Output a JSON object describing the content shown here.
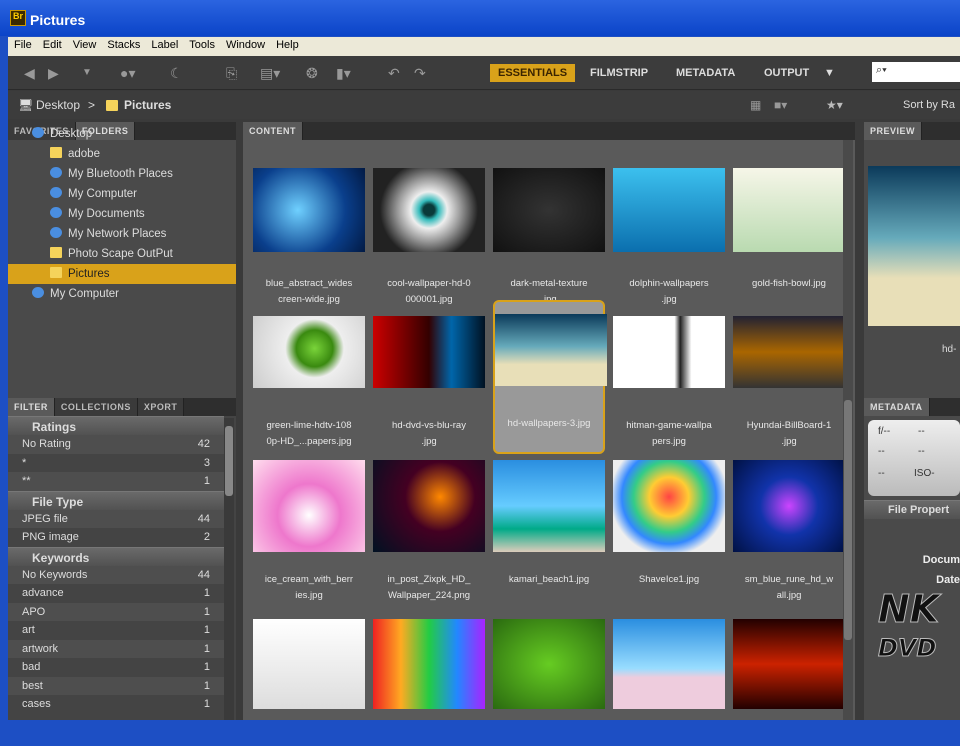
{
  "window": {
    "title": "Pictures",
    "app_icon": "Br"
  },
  "menu": [
    "File",
    "Edit",
    "View",
    "Stacks",
    "Label",
    "Tools",
    "Window",
    "Help"
  ],
  "workspaces": {
    "items": [
      "ESSENTIALS",
      "FILMSTRIP",
      "METADATA",
      "OUTPUT"
    ],
    "active": "ESSENTIALS"
  },
  "search": {
    "placeholder": "⌕▾"
  },
  "path": {
    "root": "Desktop",
    "sep": ">",
    "current": "Pictures"
  },
  "sort_label": "Sort by Ra",
  "left_tabs": [
    "FAVORITES",
    "FOLDERS"
  ],
  "tree": [
    {
      "label": "Desktop",
      "level": 0
    },
    {
      "label": "adobe",
      "level": 1
    },
    {
      "label": "My Bluetooth Places",
      "level": 1
    },
    {
      "label": "My Computer",
      "level": 1
    },
    {
      "label": "My Documents",
      "level": 1
    },
    {
      "label": "My Network Places",
      "level": 1
    },
    {
      "label": "Photo Scape OutPut",
      "level": 1
    },
    {
      "label": "Pictures",
      "level": 1,
      "selected": true
    },
    {
      "label": "My Computer",
      "level": 0
    }
  ],
  "filter_tabs": [
    "FILTER",
    "COLLECTIONS",
    "XPORT"
  ],
  "filter": [
    {
      "title": "Ratings",
      "rows": [
        {
          "label": "No Rating",
          "count": "42"
        },
        {
          "label": "*",
          "count": "3"
        },
        {
          "label": "**",
          "count": "1"
        }
      ]
    },
    {
      "title": "File Type",
      "rows": [
        {
          "label": "JPEG file",
          "count": "44"
        },
        {
          "label": "PNG image",
          "count": "2"
        }
      ]
    },
    {
      "title": "Keywords",
      "rows": [
        {
          "label": "No Keywords",
          "count": "44"
        },
        {
          "label": "advance",
          "count": "1"
        },
        {
          "label": "APO",
          "count": "1"
        },
        {
          "label": "art",
          "count": "1"
        },
        {
          "label": "artwork",
          "count": "1"
        },
        {
          "label": "bad",
          "count": "1"
        },
        {
          "label": "best",
          "count": "1"
        },
        {
          "label": "cases",
          "count": "1"
        }
      ]
    }
  ],
  "content_tab": "CONTENT",
  "thumbs": [
    {
      "l1": "blue_abstract_wides",
      "l2": "creen-wide.jpg",
      "bg": "radial-gradient(circle at 40% 50%,#6fd0ff,#0a3f8c 60%,#021a44)"
    },
    {
      "l1": "cool-wallpaper-hd-0",
      "l2": "000001.jpg",
      "bg": "radial-gradient(circle,#0a3a3a 8%,#3bb 14%,#eee 26%,#999 45%,#222 70%)"
    },
    {
      "l1": "dark-metal-texture",
      "l2": ".jpg",
      "bg": "radial-gradient(#333,#111)"
    },
    {
      "l1": "dolphin-wallpapers",
      "l2": ".jpg",
      "bg": "linear-gradient(#3cc0ee,#0b6fae)"
    },
    {
      "l1": "gold-fish-bowl.jpg",
      "l2": "",
      "bg": "linear-gradient(#f6f6e8,#b9dab0)"
    },
    {
      "l1": "green-lime-hdtv-108",
      "l2": "0p-HD_...papers.jpg",
      "bg": "radial-gradient(circle at 55% 45%,#7ad43a,#3a8a10 25%,#eee 40%,#ccc)"
    },
    {
      "l1": "hd-dvd-vs-blu-ray",
      "l2": ".jpg",
      "bg": "linear-gradient(90deg,#c00,#300 50%,#06a 70%,#012)"
    },
    {
      "l1": "hd-wallpapers-3.jpg",
      "l2": "",
      "bg": "linear-gradient(#0b3a5a,#6ab 45%,#e8dfb8 70%)",
      "selected": true
    },
    {
      "l1": "hitman-game-wallpa",
      "l2": "pers.jpg",
      "bg": "linear-gradient(90deg,#fff 55%,#222 60%,#fff 70%)"
    },
    {
      "l1": "Hyundai-BillBoard-1",
      "l2": ".jpg",
      "bg": "linear-gradient(#223,#a60 50%,#333)"
    },
    {
      "l1": "ice_cream_with_berr",
      "l2": "ies.jpg",
      "bg": "radial-gradient(circle at 50% 60%,#fff,#e7c 40%,#fde)"
    },
    {
      "l1": "in_post_Zixpk_HD_",
      "l2": "Wallpaper_224.png",
      "bg": "radial-gradient(circle at 60% 40%,#f80,#402 40%,#012)"
    },
    {
      "l1": "kamari_beach1.jpg",
      "l2": "",
      "bg": "linear-gradient(#2a8ee0,#6cf 50%,#0a8 75%,#dcb)"
    },
    {
      "l1": "ShaveIce1.jpg",
      "l2": "",
      "bg": "radial-gradient(circle at 50% 40%,#f44,#fc3 25%,#3c8 45%,#38f 60%,#eee 75%)"
    },
    {
      "l1": "sm_blue_rune_hd_w",
      "l2": "all.jpg",
      "bg": "radial-gradient(circle,#c4f,#13a 40%,#014)"
    },
    {
      "l1": "",
      "l2": "",
      "bg": "linear-gradient(#fff,#ddd)"
    },
    {
      "l1": "",
      "l2": "",
      "bg": "linear-gradient(90deg,#e22,#fa2,#2c4,#28f,#a2f)"
    },
    {
      "l1": "",
      "l2": "",
      "bg": "radial-gradient(#6c2,#2a6a10)"
    },
    {
      "l1": "",
      "l2": "",
      "bg": "linear-gradient(#2a8ee0,#9df 55%,#ecd 65%)"
    },
    {
      "l1": "",
      "l2": "",
      "bg": "linear-gradient(#200,#c20 50%,#200)"
    }
  ],
  "preview_tab": "PREVIEW",
  "preview_caption": "hd-",
  "metadata_tab": "METADATA",
  "metadata_box": {
    "aperture": "f/--",
    "v1": "--",
    "v2": "--",
    "v3": "--",
    "v4": "--",
    "iso": "ISO-"
  },
  "file_properties": {
    "title": "File Propert",
    "labels": [
      "Docum",
      "Date"
    ]
  },
  "watermark": "NK DVD"
}
